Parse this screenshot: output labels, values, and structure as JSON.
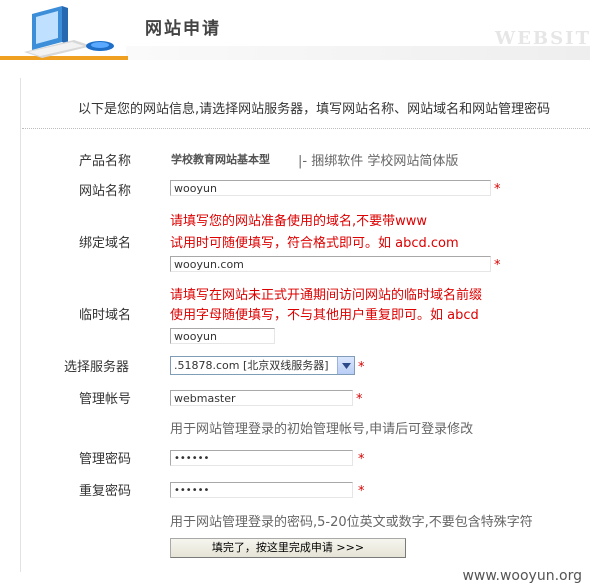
{
  "header": {
    "title": "网站申请",
    "watermark": "WEBSITE"
  },
  "intro": "以下是您的网站信息,请选择网站服务器，填写网站名称、网站域名和网站管理密码",
  "form": {
    "product": {
      "label": "产品名称",
      "name": "学校教育网站基本型",
      "suffix": "|- 捆绑软件 学校网站简体版"
    },
    "site_name": {
      "label": "网站名称",
      "value": "wooyun"
    },
    "bind_domain": {
      "label": "绑定域名",
      "hint_line1": "请填写您的网站准备使用的域名,不要带www",
      "hint_line2": "试用时可随便填写，符合格式即可。如 abcd.com",
      "value": "wooyun.com"
    },
    "temp_domain": {
      "label": "临时域名",
      "hint_line1": "请填写在网站未正式开通期间访问网站的临时域名前缀",
      "hint_line2": "使用字母随便填写，不与其他用户重复即可。如 abcd",
      "value": "wooyun"
    },
    "server": {
      "label": "选择服务器",
      "selected": ".51878.com [北京双线服务器]"
    },
    "admin_account": {
      "label": "管理帐号",
      "value": "webmaster",
      "hint": "用于网站管理登录的初始管理帐号,申请后可登录修改"
    },
    "admin_password": {
      "label": "管理密码",
      "value": "••••••"
    },
    "repeat_password": {
      "label": "重复密码",
      "value": "••••••",
      "hint": "用于网站管理登录的密码,5-20位英文或数字,不要包含特殊字符"
    },
    "required_mark": "*",
    "submit_label": "填完了，按这里完成申请 >>>"
  },
  "footer_watermark": "www.wooyun.org",
  "colors": {
    "accent_orange": "#f0a020",
    "hint_red": "#dd0000",
    "select_border": "#7f9db9"
  }
}
